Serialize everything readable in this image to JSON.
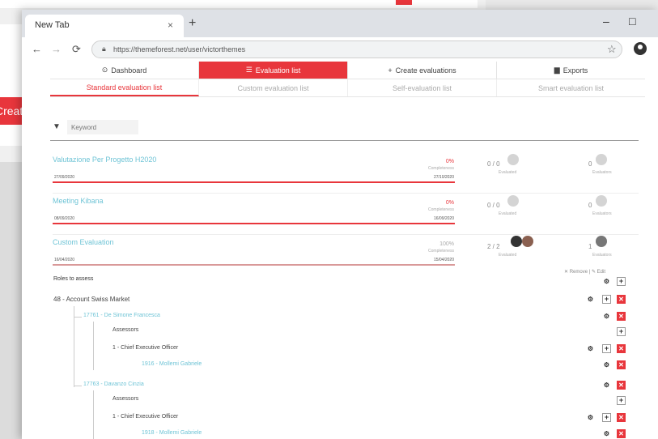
{
  "background": {
    "create_label": "Create"
  },
  "browser": {
    "tab_title": "New Tab",
    "tab_close": "×",
    "new_tab": "+",
    "minimize": "–",
    "maximize": "□",
    "url": "https://themeforest.net/user/victorthemes"
  },
  "mainnav": {
    "items": [
      {
        "label": "Dashboard",
        "icon": "dashboard-icon"
      },
      {
        "label": "Evaluation list",
        "icon": "list-icon"
      },
      {
        "label": "Create evaluations",
        "icon": "plus-icon"
      },
      {
        "label": "Exports",
        "icon": "export-icon"
      }
    ],
    "active": "Evaluation list"
  },
  "subnav": {
    "items": [
      "Standard evaluation list",
      "Custom evaluation list",
      "Self-evaluation list",
      "Smart evaluation list"
    ],
    "active": "Standard evaluation list"
  },
  "filter": {
    "placeholder": "Keyword"
  },
  "evaluations": [
    {
      "name": "Valutazione Per Progetto H2020",
      "start": "27/09/2020",
      "percent": "0%",
      "progress": 0,
      "completeness": "Completeness",
      "end": "27/10/2020",
      "evaluated": "0 / 0",
      "evaluated_label": "Evaluated",
      "evaluators": "0",
      "evaluators_label": "Evaluators"
    },
    {
      "name": "Meeting Kibana",
      "start": "08/09/2020",
      "percent": "0%",
      "progress": 0,
      "completeness": "Completeness",
      "end": "16/09/2020",
      "evaluated": "0 / 0",
      "evaluated_label": "Evaluated",
      "evaluators": "0",
      "evaluators_label": "Evaluators"
    },
    {
      "name": "Custom Evaluation",
      "start": "16/04/2020",
      "percent": "100%",
      "progress": 100,
      "completeness": "Completeness",
      "end": "15/04/2020",
      "evaluated": "2 / 2",
      "evaluated_label": "Evaluated",
      "evaluators": "1",
      "evaluators_label": "Evaluators"
    }
  ],
  "roles": {
    "title": "Roles to assess",
    "remove_label": "Remove",
    "edit_label": "Edit",
    "account": "48 - Account Swiss Market",
    "people": [
      {
        "name": "17761 - De Simone Francesca",
        "assessors_label": "Assessors",
        "role": "1 - Chief Executive Officer",
        "assessor": "1916 - Mollemi Gabriele"
      },
      {
        "name": "17763 - Davanzo Cinzia",
        "assessors_label": "Assessors",
        "role": "1 - Chief Executive Officer",
        "assessor": "1918 - Mollemi Gabriele"
      }
    ]
  },
  "colors": {
    "accent": "#e8363c",
    "link": "#6fc4d6"
  }
}
